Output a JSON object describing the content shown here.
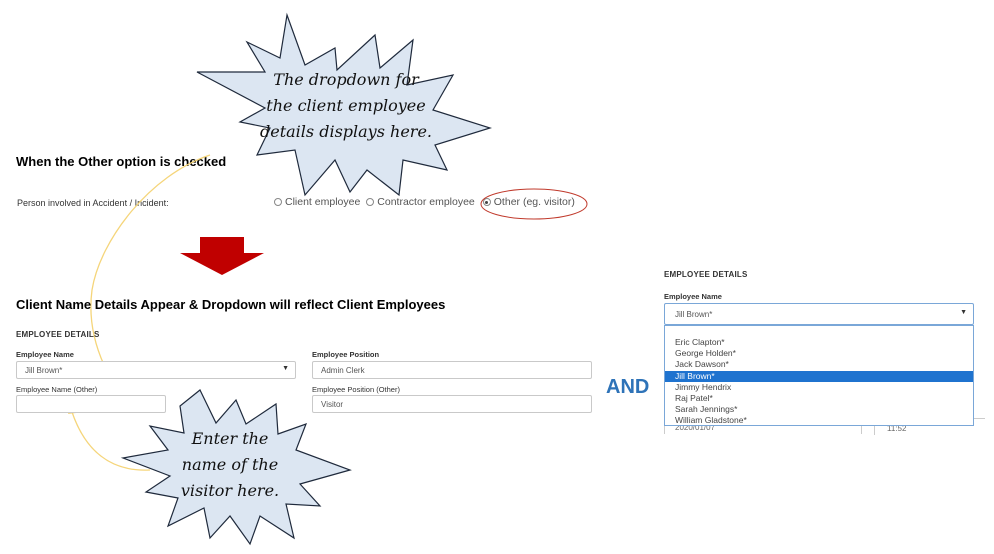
{
  "callout_top": {
    "line1": "The dropdown for",
    "line2": "the client employee",
    "line3": "details displays here."
  },
  "callout_bottom": {
    "line1": "Enter the",
    "line2": "name of the",
    "line3": "visitor here."
  },
  "section_other": {
    "heading": "When the Other option is checked",
    "person_label": "Person involved in Accident / Incident:",
    "options": [
      "Client employee",
      "Contractor employee",
      "Other (eg. visitor)"
    ],
    "selected_option": "Other (eg. visitor)"
  },
  "section_client": {
    "heading": "Client Name Details Appear & Dropdown will reflect Client Employees",
    "title": "EMPLOYEE DETAILS",
    "employee_name_label": "Employee Name",
    "employee_name_value": "Jill Brown*",
    "employee_position_label": "Employee Position",
    "employee_position_value": "Admin Clerk",
    "employee_name_other_label": "Employee Name (Other)",
    "employee_name_other_value": "",
    "employee_position_other_label": "Employee Position (Other)",
    "employee_position_other_value": "Visitor"
  },
  "and_label": "AND",
  "right_panel": {
    "title": "EMPLOYEE DETAILS",
    "employee_name_label": "Employee Name",
    "selected_value": "Jill Brown*",
    "options": [
      "Eric Clapton*",
      "George Holden*",
      "Jack Dawson*",
      "Jill Brown*",
      "Jimmy Hendrix",
      "Raj Patel*",
      "Sarah Jennings*",
      "William Gladstone*"
    ],
    "selected_index": 3,
    "hidden_date": "2020/01/07",
    "hidden_time": "11:52"
  },
  "colors": {
    "accent_blue": "#2e73b8",
    "arrow_red": "#c00000",
    "callout_fill": "#dce6f2",
    "callout_stroke": "#1f2a3c",
    "highlight": "#1f73cf",
    "circle_red": "#c0392b"
  }
}
